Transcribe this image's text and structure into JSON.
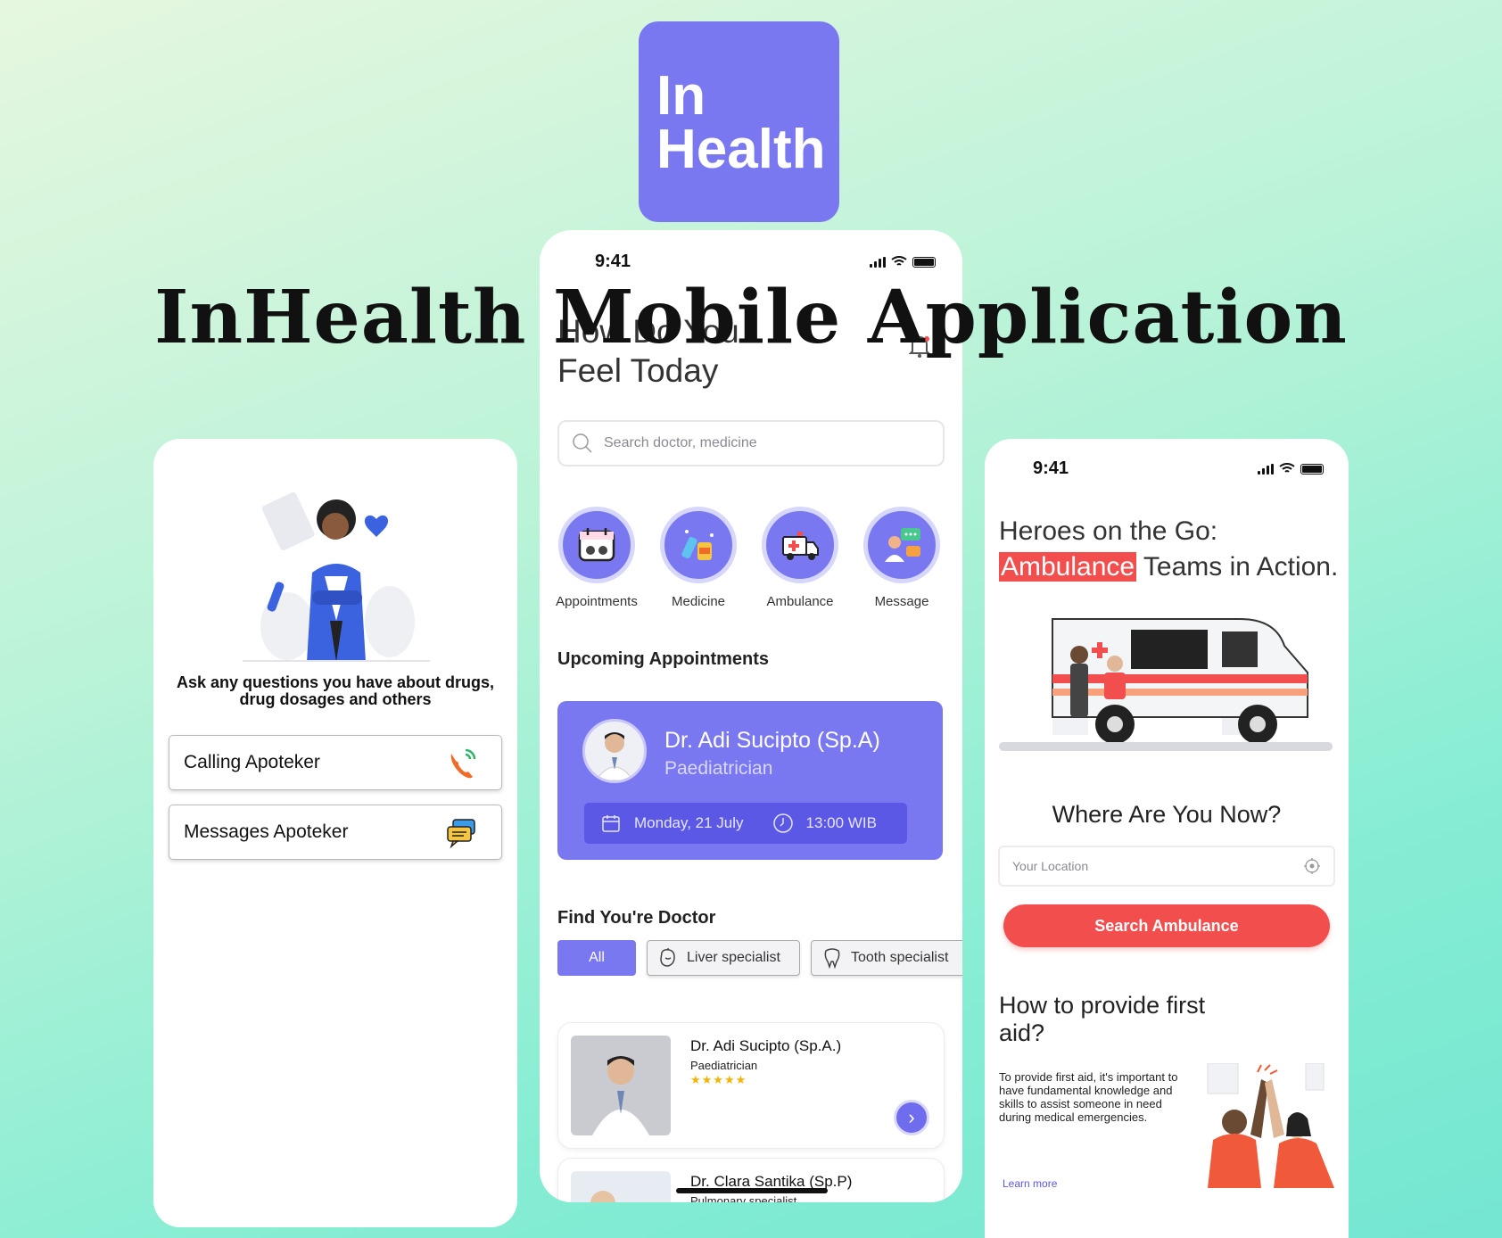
{
  "logo": {
    "line1": "In",
    "line2": "Health"
  },
  "title": "InHealth Mobile Application",
  "left_screen": {
    "prompt": "Ask any questions you have about drugs, drug dosages and others",
    "buttons": [
      {
        "label": "Calling Apoteker",
        "icon": "phone-call-icon"
      },
      {
        "label": "Messages Apoteker",
        "icon": "chat-bubbles-icon"
      }
    ]
  },
  "center_screen": {
    "status": {
      "time": "9:41"
    },
    "greeting_line1": "How Do You",
    "greeting_line2": "Feel Today",
    "search": {
      "placeholder": "Search doctor, medicine"
    },
    "categories": [
      {
        "label": "Appointments",
        "icon": "calendar-icon"
      },
      {
        "label": "Medicine",
        "icon": "medicine-icon"
      },
      {
        "label": "Ambulance",
        "icon": "ambulance-icon"
      },
      {
        "label": "Message",
        "icon": "message-icon"
      }
    ],
    "upcoming_title": "Upcoming Appointments",
    "appointment": {
      "doctor": "Dr. Adi Sucipto (Sp.A)",
      "specialty": "Paediatrician",
      "date": "Monday, 21 July",
      "time": "13:00 WIB"
    },
    "find_title": "Find You're Doctor",
    "filters": [
      {
        "label": "All",
        "active": true
      },
      {
        "label": "Liver specialist",
        "icon": "liver-icon"
      },
      {
        "label": "Tooth specialist",
        "icon": "tooth-icon"
      }
    ],
    "doctors": [
      {
        "name": "Dr. Adi Sucipto (Sp.A.)",
        "specialty": "Paediatrician",
        "rating": 5,
        "stars": "★★★★★"
      },
      {
        "name": "Dr. Clara Santika (Sp.P)",
        "specialty": "Pulmonary specialist"
      }
    ]
  },
  "right_screen": {
    "status": {
      "time": "9:41"
    },
    "headline_line1": "Heroes on the Go:",
    "headline_highlight": "Ambulance",
    "headline_rest": " Teams in Action.",
    "where_title": "Where Are You Now?",
    "location": {
      "placeholder": "Your Location"
    },
    "search_button": "Search Ambulance",
    "aid_title": "How to provide first aid?",
    "aid_text": "To provide first aid, it's important to have fundamental knowledge and skills to assist someone in need during medical emergencies.",
    "learn_more": "Learn more"
  },
  "colors": {
    "primary": "#7a78f0",
    "accent": "#f24e4e",
    "background_start": "#e6f7df",
    "background_end": "#74e6d2"
  }
}
